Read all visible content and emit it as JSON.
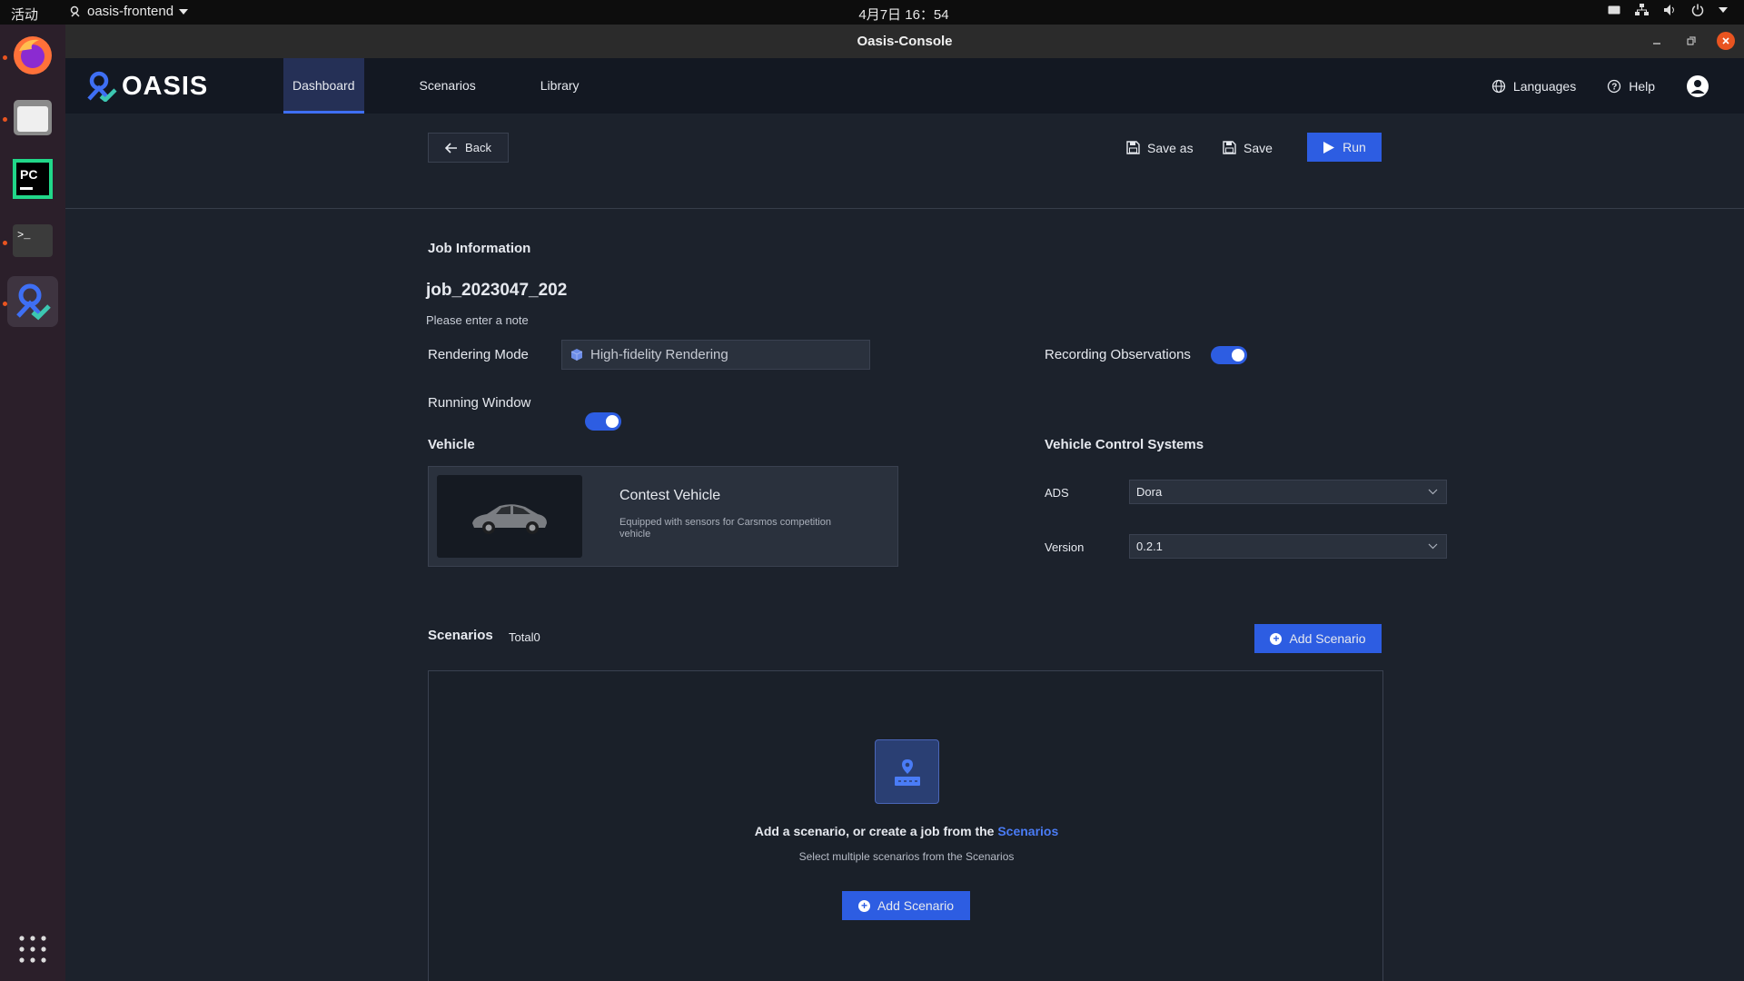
{
  "system": {
    "activities": "活动",
    "app_menu": "oasis-frontend",
    "clock": "4月7日 16：54"
  },
  "window": {
    "title": "Oasis-Console"
  },
  "header": {
    "logo": "OASIS",
    "nav": [
      {
        "label": "Dashboard",
        "active": true
      },
      {
        "label": "Scenarios",
        "active": false
      },
      {
        "label": "Library",
        "active": false
      }
    ],
    "languages": "Languages",
    "help": "Help"
  },
  "toolbar": {
    "back": "Back",
    "save_as": "Save as",
    "save": "Save",
    "run": "Run"
  },
  "job": {
    "section_title": "Job Information",
    "name": "job_2023047_202",
    "note": "Please enter a note",
    "rendering_mode_label": "Rendering Mode",
    "rendering_mode_value": "High-fidelity Rendering",
    "recording_label": "Recording Observations",
    "recording_on": true,
    "running_window_label": "Running Window",
    "running_window_on": true
  },
  "vehicle": {
    "section_title": "Vehicle",
    "name": "Contest Vehicle",
    "description": "Equipped with sensors for Carsmos competition vehicle"
  },
  "control": {
    "section_title": "Vehicle Control Systems",
    "ads_label": "ADS",
    "ads_value": "Dora",
    "version_label": "Version",
    "version_value": "0.2.1"
  },
  "scenarios": {
    "title": "Scenarios",
    "total": "Total0",
    "add_button": "Add Scenario",
    "empty_title": "Add a scenario, or create a job from the ",
    "empty_link": "Scenarios",
    "empty_sub": "Select multiple scenarios from the Scenarios",
    "empty_add_button": "Add Scenario"
  },
  "colors": {
    "accent": "#2d5de2",
    "background": "#1c222c",
    "header": "#131822",
    "dock": "#2b1f2a"
  }
}
